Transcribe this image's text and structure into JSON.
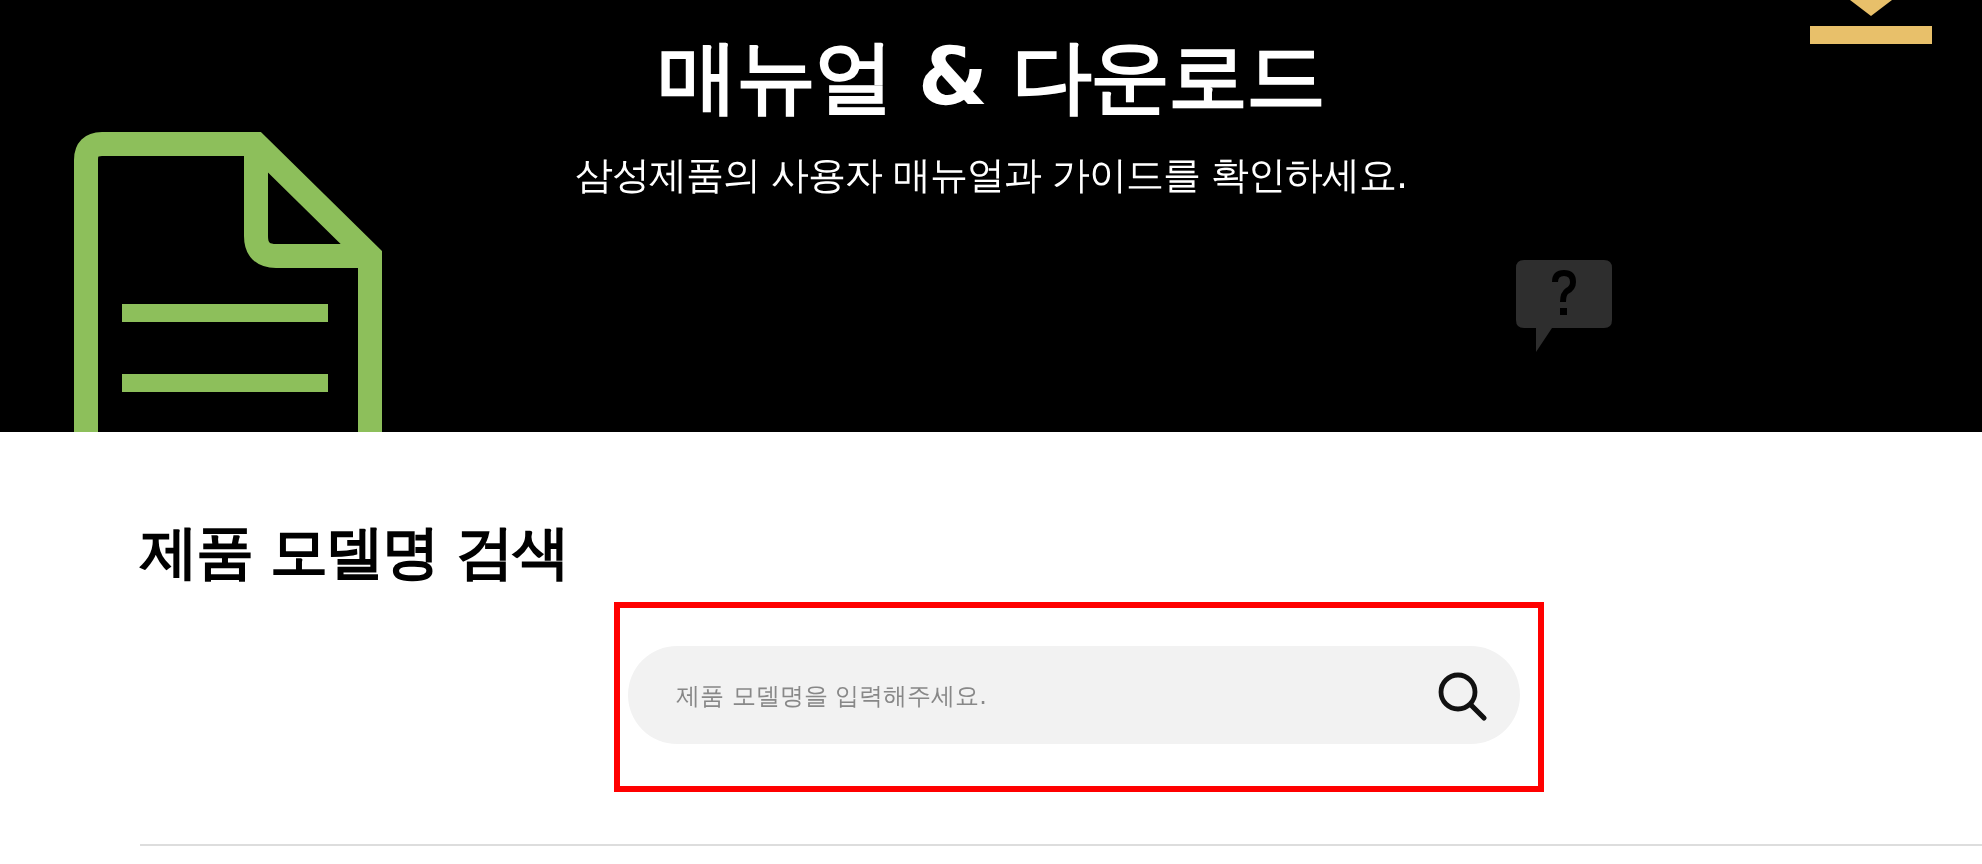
{
  "banner": {
    "title": "매뉴얼 & 다운로드",
    "subtitle": "삼성제품의 사용자 매뉴얼과 가이드를 확인하세요."
  },
  "search_section": {
    "heading": "제품 모델명 검색",
    "highlighted": true,
    "search": {
      "placeholder": "제품 모델명을 입력해주세요."
    }
  }
}
